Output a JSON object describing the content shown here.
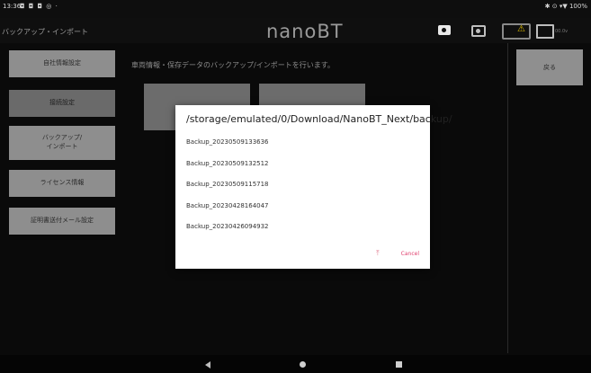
{
  "status_bar": {
    "time": "13:36",
    "icons": "◘ ◘ ◘ ◎ ·",
    "system": "✱ ⊙ ▾▼ 100%"
  },
  "header": {
    "screen_title": "バックアップ・インポート",
    "app_title": "nanoBT",
    "voltage": "00.0v",
    "warning_symbol": "⚠"
  },
  "menu": {
    "items": [
      {
        "label": "自社情報設定"
      },
      {
        "label": "接続設定"
      },
      {
        "label": "バックアップ/\nインポート"
      },
      {
        "label": "ライセンス情報"
      },
      {
        "label": "証明書送付メール設定"
      }
    ]
  },
  "main": {
    "description": "車両情報・保存データのバックアップ/インポートを行います。"
  },
  "right": {
    "back_label": "戻る"
  },
  "dialog": {
    "path": "/storage/emulated/0/Download/NanoBT_Next/backup/",
    "files": [
      "Backup_20230509133636",
      "Backup_20230509132512",
      "Backup_20230509115718",
      "Backup_20230428164047",
      "Backup_20230426094932"
    ],
    "up_symbol": "⤒",
    "cancel_label": "Cancel"
  },
  "colors": {
    "accent": "#e0406e",
    "menu_button": "#8e8e8e",
    "background": "#0a0a0a"
  }
}
